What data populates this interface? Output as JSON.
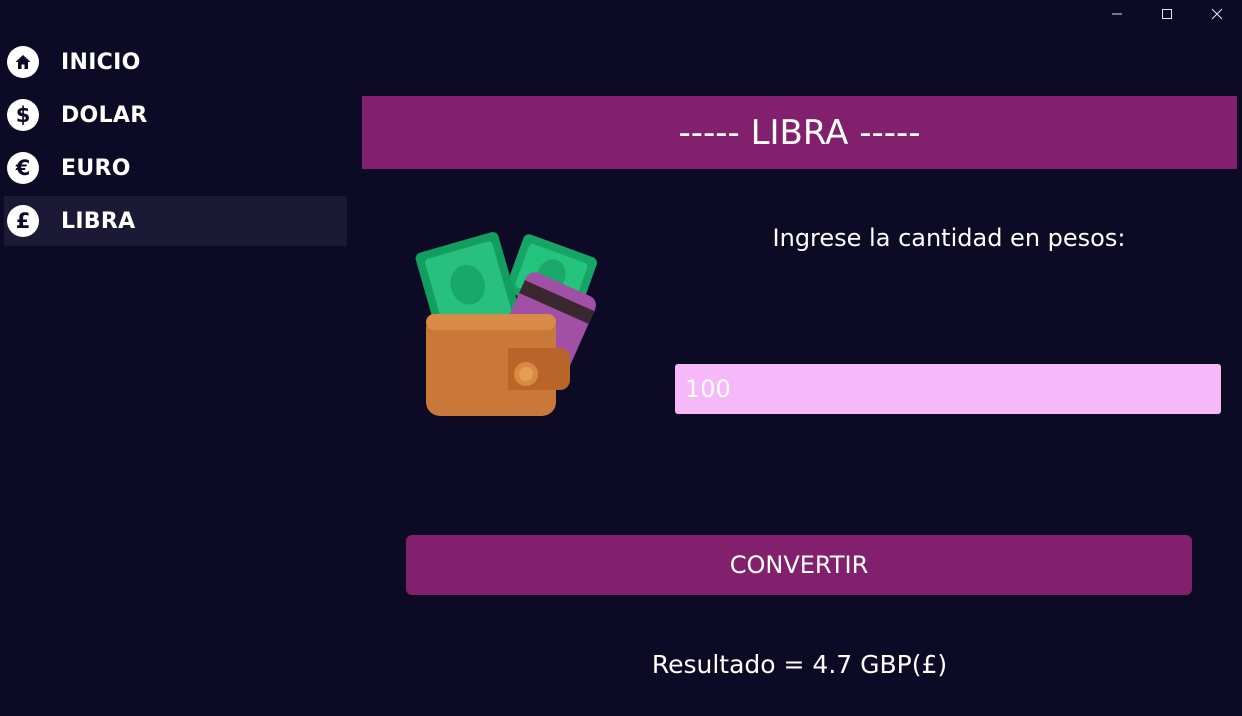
{
  "window": {
    "controls": [
      {
        "name": "minimize-icon"
      },
      {
        "name": "maximize-icon"
      },
      {
        "name": "close-icon"
      }
    ]
  },
  "sidebar": {
    "items": [
      {
        "label": "INICIO",
        "icon": "home-icon",
        "glyph": "⌂",
        "active": false
      },
      {
        "label": "DOLAR",
        "icon": "dollar-icon",
        "glyph": "$",
        "active": false
      },
      {
        "label": "EURO",
        "icon": "euro-icon",
        "glyph": "€",
        "active": false
      },
      {
        "label": "LIBRA",
        "icon": "pound-icon",
        "glyph": "£",
        "active": true
      }
    ]
  },
  "main": {
    "banner_title": "----- LIBRA -----",
    "illustration": "wallet-with-cash-icon",
    "prompt": "Ingrese la cantidad en pesos:",
    "amount_value": "100",
    "convert_label": "CONVERTIR",
    "result_text": "Resultado = 4.7 GBP(£)"
  },
  "colors": {
    "background": "#0c0a24",
    "accent": "#83206e",
    "input_bg": "#f6b8f8",
    "active_item_bg": "#1b1935"
  }
}
